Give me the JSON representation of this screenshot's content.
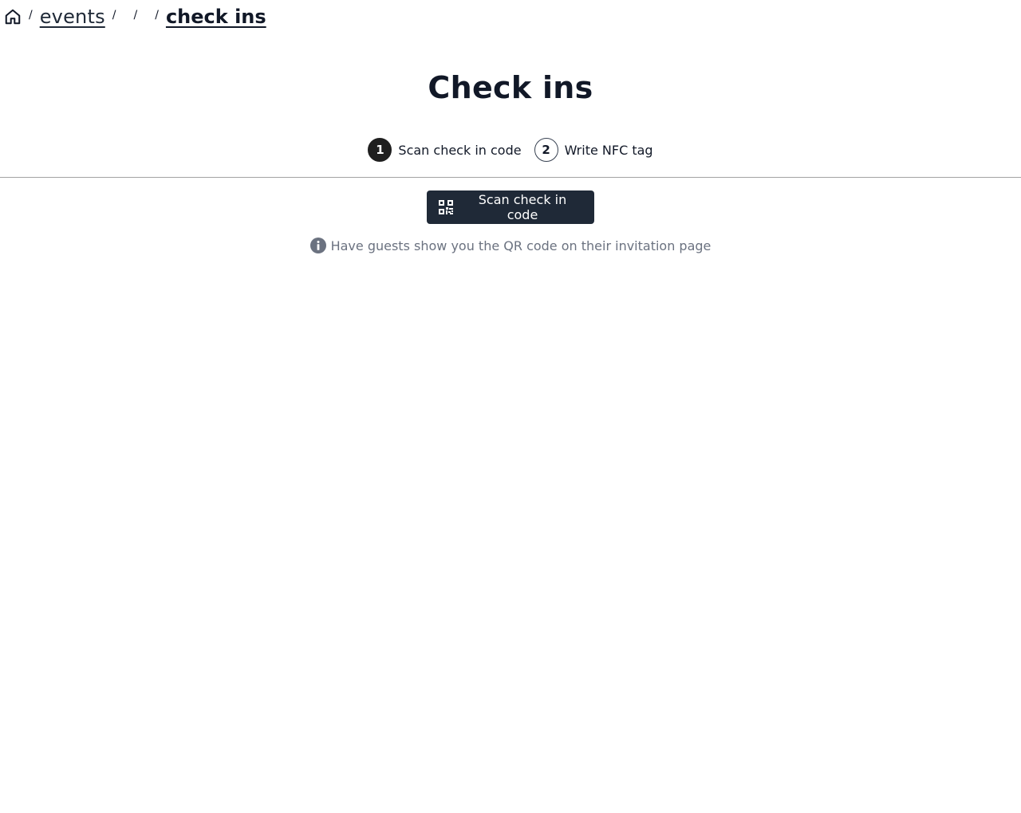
{
  "breadcrumb": {
    "home_icon": "home-icon",
    "separator": "/",
    "items": [
      {
        "label": "events"
      },
      {
        "label": ""
      },
      {
        "label": ""
      },
      {
        "label": "check ins"
      }
    ]
  },
  "page": {
    "title": "Check ins"
  },
  "steps": [
    {
      "number": "1",
      "label": "Scan check in code",
      "state": "active"
    },
    {
      "number": "2",
      "label": "Write NFC tag",
      "state": "inactive"
    }
  ],
  "scan_button": {
    "label": "Scan check in code",
    "icon": "qr-code-icon"
  },
  "hint": {
    "icon": "info-icon",
    "text": "Have guests show you the QR code on their invitation page"
  },
  "colors": {
    "primary_button": "#1f2937",
    "active_step": "#1f1f1f",
    "hint_text": "#6b7280"
  }
}
